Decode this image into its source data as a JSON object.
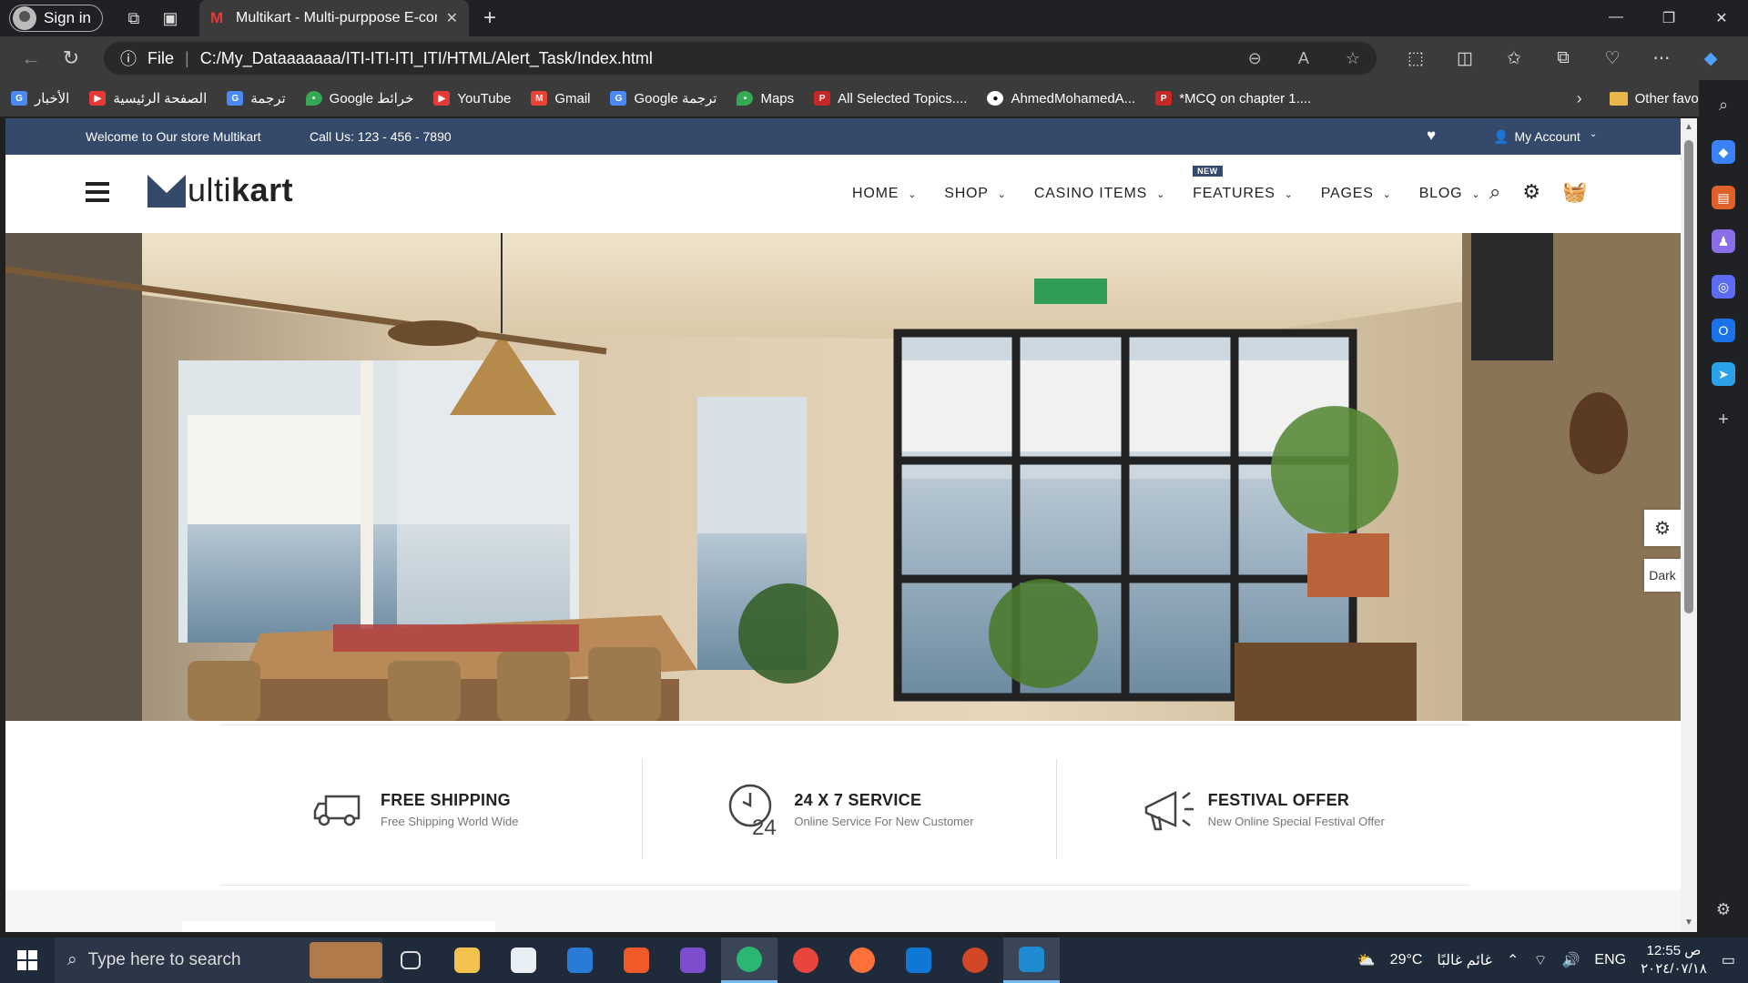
{
  "browser": {
    "signin_label": "Sign in",
    "tab_title": "Multikart - Multi-purppose E-com",
    "address_scheme": "File",
    "address_url": "C:/My_Dataaaaaaa/ITI-ITI-ITI_ITI/HTML/Alert_Task/Index.html",
    "bookmarks": [
      {
        "label": "الأخبار",
        "color": "#4a8af4",
        "icon": "news-icon"
      },
      {
        "label": "الصفحة الرئيسية",
        "color": "#e53935",
        "icon": "youtube-icon"
      },
      {
        "label": "ترجمة",
        "color": "#4a8af4",
        "icon": "translate-icon"
      },
      {
        "label": "Google خرائط",
        "color": "#34a853",
        "icon": "maps-icon"
      },
      {
        "label": "YouTube",
        "color": "#e53935",
        "icon": "youtube-icon"
      },
      {
        "label": "Gmail",
        "color": "#ea4335",
        "icon": "gmail-icon"
      },
      {
        "label": "Google ترجمة",
        "color": "#4a8af4",
        "icon": "translate-icon"
      },
      {
        "label": "Maps",
        "color": "#34a853",
        "icon": "maps-icon"
      },
      {
        "label": "All Selected Topics....",
        "color": "#c62828",
        "icon": "pdf-icon"
      },
      {
        "label": "AhmedMohamedA...",
        "color": "#333333",
        "icon": "github-icon"
      },
      {
        "label": "*MCQ on chapter 1....",
        "color": "#c62828",
        "icon": "pdf-icon"
      }
    ],
    "other_favorites": "Other favorites"
  },
  "site": {
    "welcome": "Welcome to Our store Multikart",
    "call": "Call Us: 123 - 456 - 7890",
    "my_account": "My Account",
    "logo_light": "ulti",
    "logo_bold": "kart",
    "menu": [
      {
        "label": "HOME"
      },
      {
        "label": "SHOP"
      },
      {
        "label": "CASINO ITEMS"
      },
      {
        "label": "FEATURES",
        "badge": "NEW"
      },
      {
        "label": "PAGES"
      },
      {
        "label": "BLOG"
      }
    ],
    "services": [
      {
        "title": "FREE SHIPPING",
        "subtitle": "Free Shipping World Wide",
        "icon": "truck-icon"
      },
      {
        "title": "24 X 7 SERVICE",
        "subtitle": "Online Service For New Customer",
        "icon": "clock-24-icon"
      },
      {
        "title": "FESTIVAL OFFER",
        "subtitle": "New Online Special Festival Offer",
        "icon": "megaphone-icon"
      }
    ],
    "dark_label": "Dark",
    "brand_color": "#354a6a"
  },
  "taskbar": {
    "search_placeholder": "Type here to search",
    "weather": "29°C",
    "weather_text": "غائم غالبًا",
    "lang": "ENG",
    "time": "12:55 ص",
    "date": "٢٠٢٤/٠٧/١٨"
  }
}
